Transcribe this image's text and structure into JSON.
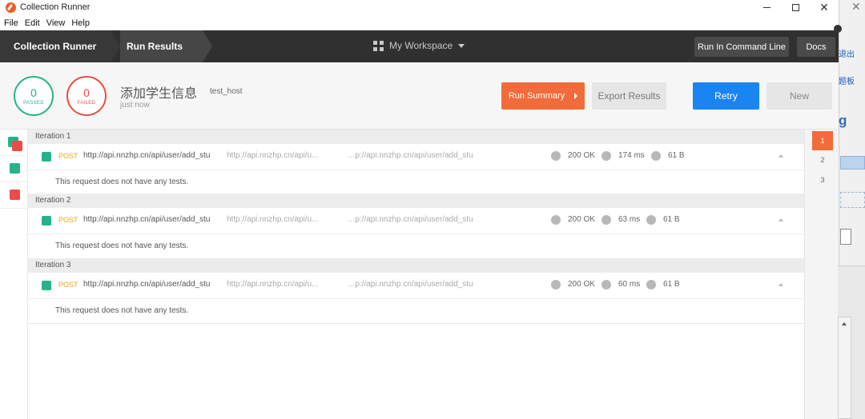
{
  "window": {
    "title": "Collection Runner"
  },
  "menu": [
    "File",
    "Edit",
    "View",
    "Help"
  ],
  "header": {
    "crumbs": [
      "Collection Runner",
      "Run Results"
    ],
    "workspace": "My Workspace",
    "cmd_label": "Run In Command Line",
    "docs_label": "Docs"
  },
  "summary": {
    "passed": {
      "count": "0",
      "label": "PASSED"
    },
    "failed": {
      "count": "0",
      "label": "FAILED"
    },
    "name": "添加学生信息",
    "environment": "test_host",
    "time": "just now",
    "run_summary": "Run Summary",
    "export": "Export Results",
    "retry": "Retry",
    "new": "New"
  },
  "iterations": [
    {
      "title": "Iteration 1",
      "method": "POST",
      "url": "http://api.nnzhp.cn/api/user/add_stu",
      "url_faded": "http://api.nnzhp.cn/api/u...",
      "url_tail": "...p://api.nnzhp.cn/api/user/add_stu",
      "status": "200 OK",
      "time": "174 ms",
      "size": "61 B",
      "note": "This request does not have any tests."
    },
    {
      "title": "Iteration 2",
      "method": "POST",
      "url": "http://api.nnzhp.cn/api/user/add_stu",
      "url_faded": "http://api.nnzhp.cn/api/u...",
      "url_tail": "...p://api.nnzhp.cn/api/user/add_stu",
      "status": "200 OK",
      "time": "63 ms",
      "size": "61 B",
      "note": "This request does not have any tests."
    },
    {
      "title": "Iteration 3",
      "method": "POST",
      "url": "http://api.nnzhp.cn/api/user/add_stu",
      "url_faded": "http://api.nnzhp.cn/api/u...",
      "url_tail": "...p://api.nnzhp.cn/api/user/add_stu",
      "status": "200 OK",
      "time": "60 ms",
      "size": "61 B",
      "note": "This request does not have any tests."
    }
  ],
  "index": [
    "1",
    "2",
    "3"
  ],
  "background_window": {
    "text1": "退出",
    "text2": "题板",
    "text3": "g"
  },
  "colors": {
    "accent": "#f26b3a",
    "primary": "#1a85f0",
    "pass": "#25b38a",
    "fail": "#ed4b48",
    "header": "#303030"
  }
}
